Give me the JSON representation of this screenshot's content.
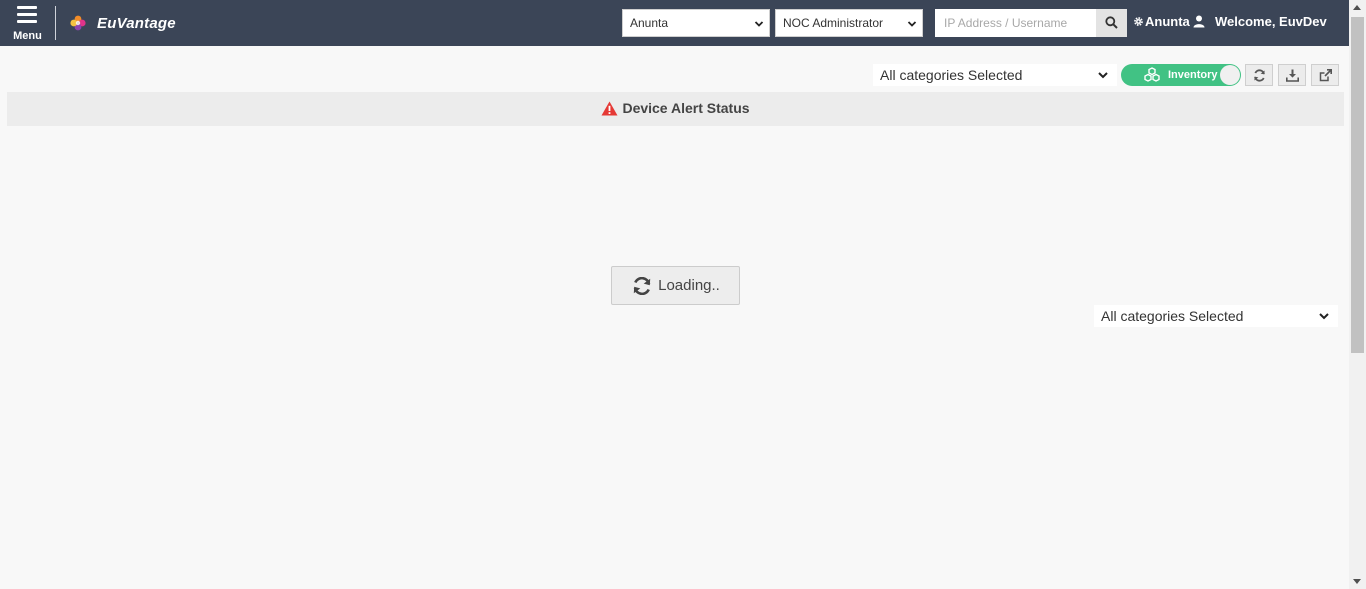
{
  "header": {
    "menu_label": "Menu",
    "brand": "EuVantage",
    "org_select_value": "Anunta",
    "role_select_value": "NOC Administrator",
    "search_placeholder": "IP Address / Username",
    "tenant": "Anunta",
    "welcome": "Welcome, EuvDev",
    "bg_color": "#3b4557"
  },
  "toolbar": {
    "category_select_value": "All categories Selected",
    "inventory_toggle_label": "Inventory",
    "inventory_toggle_color": "#41c284",
    "refresh_icon": "refresh-icon",
    "download_icon": "download-icon",
    "external_icon": "external-link-icon"
  },
  "panel": {
    "title": "Device Alert Status",
    "alert_icon": "warning-icon",
    "alert_color": "#e53935",
    "loading_text": "Loading..",
    "category_select_value": "All categories Selected"
  }
}
